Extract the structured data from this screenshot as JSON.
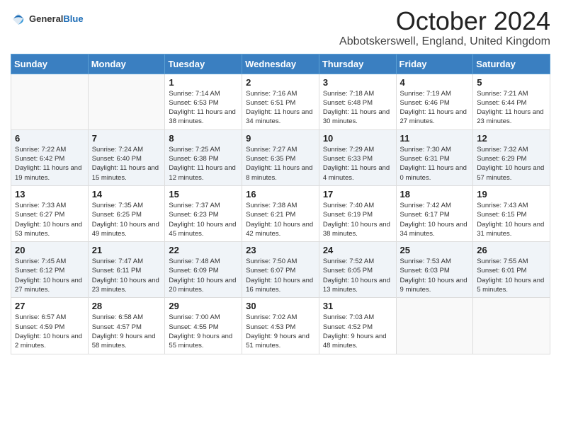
{
  "logo": {
    "general": "General",
    "blue": "Blue"
  },
  "title": "October 2024",
  "location": "Abbotskerswell, England, United Kingdom",
  "days_of_week": [
    "Sunday",
    "Monday",
    "Tuesday",
    "Wednesday",
    "Thursday",
    "Friday",
    "Saturday"
  ],
  "weeks": [
    [
      {
        "day": "",
        "detail": ""
      },
      {
        "day": "",
        "detail": ""
      },
      {
        "day": "1",
        "detail": "Sunrise: 7:14 AM\nSunset: 6:53 PM\nDaylight: 11 hours and 38 minutes."
      },
      {
        "day": "2",
        "detail": "Sunrise: 7:16 AM\nSunset: 6:51 PM\nDaylight: 11 hours and 34 minutes."
      },
      {
        "day": "3",
        "detail": "Sunrise: 7:18 AM\nSunset: 6:48 PM\nDaylight: 11 hours and 30 minutes."
      },
      {
        "day": "4",
        "detail": "Sunrise: 7:19 AM\nSunset: 6:46 PM\nDaylight: 11 hours and 27 minutes."
      },
      {
        "day": "5",
        "detail": "Sunrise: 7:21 AM\nSunset: 6:44 PM\nDaylight: 11 hours and 23 minutes."
      }
    ],
    [
      {
        "day": "6",
        "detail": "Sunrise: 7:22 AM\nSunset: 6:42 PM\nDaylight: 11 hours and 19 minutes."
      },
      {
        "day": "7",
        "detail": "Sunrise: 7:24 AM\nSunset: 6:40 PM\nDaylight: 11 hours and 15 minutes."
      },
      {
        "day": "8",
        "detail": "Sunrise: 7:25 AM\nSunset: 6:38 PM\nDaylight: 11 hours and 12 minutes."
      },
      {
        "day": "9",
        "detail": "Sunrise: 7:27 AM\nSunset: 6:35 PM\nDaylight: 11 hours and 8 minutes."
      },
      {
        "day": "10",
        "detail": "Sunrise: 7:29 AM\nSunset: 6:33 PM\nDaylight: 11 hours and 4 minutes."
      },
      {
        "day": "11",
        "detail": "Sunrise: 7:30 AM\nSunset: 6:31 PM\nDaylight: 11 hours and 0 minutes."
      },
      {
        "day": "12",
        "detail": "Sunrise: 7:32 AM\nSunset: 6:29 PM\nDaylight: 10 hours and 57 minutes."
      }
    ],
    [
      {
        "day": "13",
        "detail": "Sunrise: 7:33 AM\nSunset: 6:27 PM\nDaylight: 10 hours and 53 minutes."
      },
      {
        "day": "14",
        "detail": "Sunrise: 7:35 AM\nSunset: 6:25 PM\nDaylight: 10 hours and 49 minutes."
      },
      {
        "day": "15",
        "detail": "Sunrise: 7:37 AM\nSunset: 6:23 PM\nDaylight: 10 hours and 45 minutes."
      },
      {
        "day": "16",
        "detail": "Sunrise: 7:38 AM\nSunset: 6:21 PM\nDaylight: 10 hours and 42 minutes."
      },
      {
        "day": "17",
        "detail": "Sunrise: 7:40 AM\nSunset: 6:19 PM\nDaylight: 10 hours and 38 minutes."
      },
      {
        "day": "18",
        "detail": "Sunrise: 7:42 AM\nSunset: 6:17 PM\nDaylight: 10 hours and 34 minutes."
      },
      {
        "day": "19",
        "detail": "Sunrise: 7:43 AM\nSunset: 6:15 PM\nDaylight: 10 hours and 31 minutes."
      }
    ],
    [
      {
        "day": "20",
        "detail": "Sunrise: 7:45 AM\nSunset: 6:12 PM\nDaylight: 10 hours and 27 minutes."
      },
      {
        "day": "21",
        "detail": "Sunrise: 7:47 AM\nSunset: 6:11 PM\nDaylight: 10 hours and 23 minutes."
      },
      {
        "day": "22",
        "detail": "Sunrise: 7:48 AM\nSunset: 6:09 PM\nDaylight: 10 hours and 20 minutes."
      },
      {
        "day": "23",
        "detail": "Sunrise: 7:50 AM\nSunset: 6:07 PM\nDaylight: 10 hours and 16 minutes."
      },
      {
        "day": "24",
        "detail": "Sunrise: 7:52 AM\nSunset: 6:05 PM\nDaylight: 10 hours and 13 minutes."
      },
      {
        "day": "25",
        "detail": "Sunrise: 7:53 AM\nSunset: 6:03 PM\nDaylight: 10 hours and 9 minutes."
      },
      {
        "day": "26",
        "detail": "Sunrise: 7:55 AM\nSunset: 6:01 PM\nDaylight: 10 hours and 5 minutes."
      }
    ],
    [
      {
        "day": "27",
        "detail": "Sunrise: 6:57 AM\nSunset: 4:59 PM\nDaylight: 10 hours and 2 minutes."
      },
      {
        "day": "28",
        "detail": "Sunrise: 6:58 AM\nSunset: 4:57 PM\nDaylight: 9 hours and 58 minutes."
      },
      {
        "day": "29",
        "detail": "Sunrise: 7:00 AM\nSunset: 4:55 PM\nDaylight: 9 hours and 55 minutes."
      },
      {
        "day": "30",
        "detail": "Sunrise: 7:02 AM\nSunset: 4:53 PM\nDaylight: 9 hours and 51 minutes."
      },
      {
        "day": "31",
        "detail": "Sunrise: 7:03 AM\nSunset: 4:52 PM\nDaylight: 9 hours and 48 minutes."
      },
      {
        "day": "",
        "detail": ""
      },
      {
        "day": "",
        "detail": ""
      }
    ]
  ]
}
